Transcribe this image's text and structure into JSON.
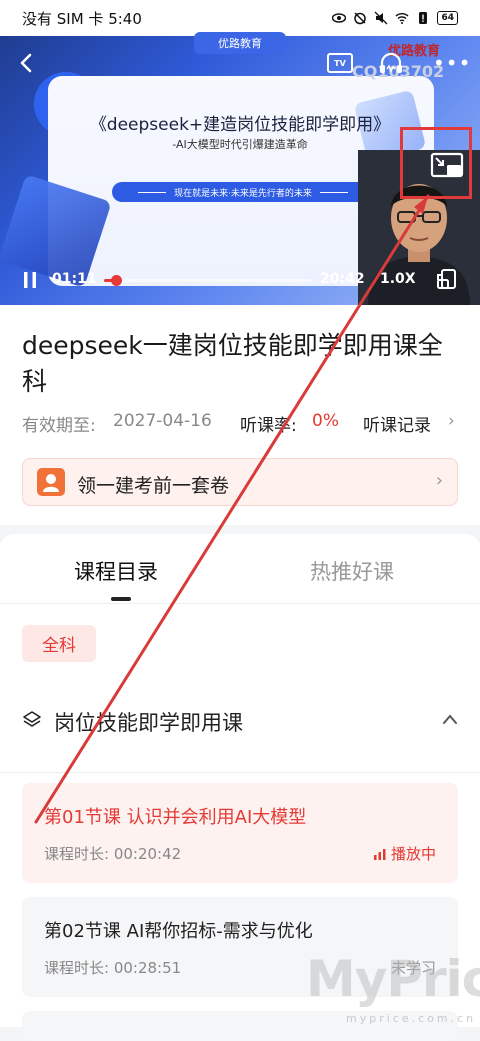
{
  "status_bar": {
    "carrier_time": "没有 SIM 卡 5:40",
    "battery": "64"
  },
  "player": {
    "brand": "优路教育",
    "tv_label": "TV",
    "slide": {
      "logo": "优路教育",
      "code": "CQ103702",
      "title": "《deepseek+建造岗位技能即学即用》",
      "subtitle": "-AI大模型时代引爆建造革命",
      "pill": "现在就是未来·未来是先行者的未来"
    },
    "current_time": "01:11",
    "total_time": "20:42",
    "speed": "1.0X",
    "progress": 0.057
  },
  "course": {
    "title": "deepseek一建岗位技能即学即用课全科",
    "validity_label": "有效期至:",
    "validity_date": "2027-04-16",
    "rate_label": "听课率:",
    "rate_value": "0%",
    "record_link": "听课记录",
    "promo_label": "领一建考前一套卷"
  },
  "tabs": {
    "catalog": "课程目录",
    "recommend": "热推好课"
  },
  "filter_chip": "全科",
  "chapter": {
    "title": "岗位技能即学即用课"
  },
  "lessons": [
    {
      "title": "第01节课 认识并会利用AI大模型",
      "duration": "课程时长:  00:20:42",
      "status": "播放中"
    },
    {
      "title": "第02节课 AI帮你招标-需求与优化",
      "duration": "课程时长:  00:28:51",
      "status": "未学习"
    }
  ],
  "watermark": {
    "brand": "MyPrice",
    "url": "myprice.com.cn"
  },
  "colors": {
    "accent": "#e53935",
    "annotation": "#d93a3a"
  }
}
